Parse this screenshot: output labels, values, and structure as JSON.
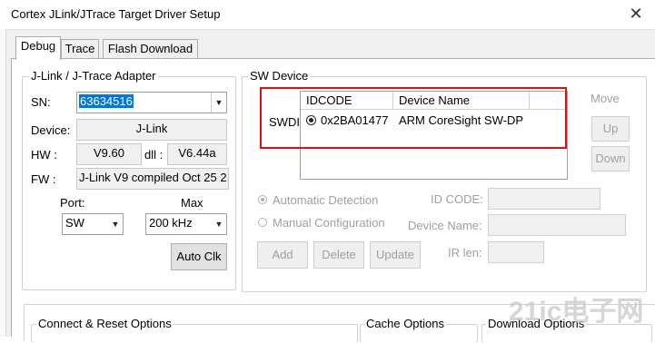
{
  "window": {
    "title": "Cortex JLink/JTrace Target Driver Setup",
    "close_glyph": "✕"
  },
  "tabs": [
    {
      "label": "Debug",
      "active": true
    },
    {
      "label": "Trace"
    },
    {
      "label": "Flash Download"
    }
  ],
  "adapter": {
    "legend": "J-Link / J-Trace Adapter",
    "sn_label": "SN:",
    "sn_value": "63634516",
    "device_label": "Device:",
    "device_value": "J-Link",
    "hw_label": "HW :",
    "hw_value": "V9.60",
    "dll_label": "dll :",
    "dll_value": "V6.44a",
    "fw_label": "FW :",
    "fw_value": "J-Link V9 compiled Oct 25 2",
    "port_label": "Port:",
    "port_value": "SW",
    "max_label": "Max",
    "max_value": "200 kHz",
    "auto_clk_label": "Auto Clk"
  },
  "sw_device": {
    "legend": "SW Device",
    "row_label": "SWDI",
    "columns": [
      "IDCODE",
      "Device Name"
    ],
    "rows": [
      {
        "idcode": "0x2BA01477",
        "device_name": "ARM CoreSight SW-DP"
      }
    ],
    "move_label": "Move",
    "up_label": "Up",
    "down_label": "Down",
    "auto_detect_label": "Automatic Detection",
    "manual_config_label": "Manual Configuration",
    "id_code_label": "ID CODE:",
    "device_name_label": "Device Name:",
    "ir_len_label": "IR len:",
    "add_label": "Add",
    "delete_label": "Delete",
    "update_label": "Update"
  },
  "bottom_groups": {
    "connect_reset": "Connect & Reset Options",
    "cache": "Cache Options",
    "download": "Download Options"
  },
  "watermark": "21ic电子网",
  "colors": {
    "highlight": "#e01010",
    "selection": "#0078d7"
  }
}
